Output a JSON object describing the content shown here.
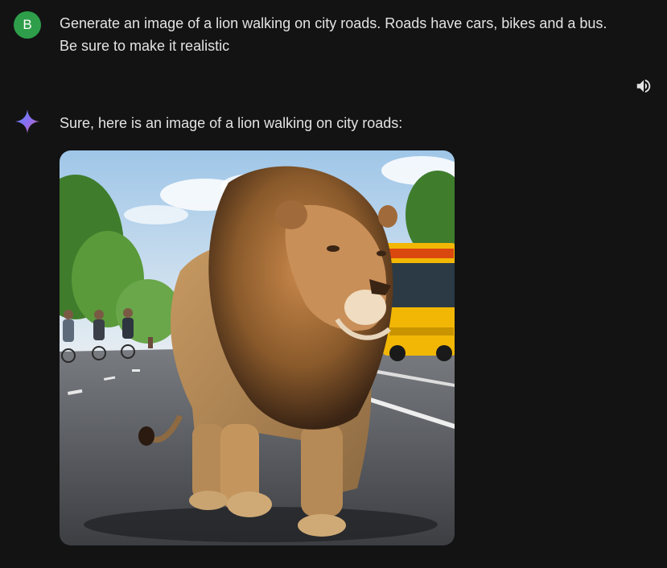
{
  "user": {
    "avatar_initial": "B",
    "avatar_color": "#2e9e4a",
    "prompt_line1": "Generate an image of a lion walking on city roads. Roads have cars, bikes and a bus.",
    "prompt_line2": "Be sure to make it realistic"
  },
  "response": {
    "speaker_icon": "speaker-volume-icon",
    "assistant_icon": "gemini-sparkle-icon",
    "text": "Sure, here is an image of a lion walking on city roads:",
    "image": {
      "subject": "lion walking on city road with cyclists and a yellow bus"
    }
  },
  "colors": {
    "background": "#131314",
    "text": "#e3e3e3",
    "bus": "#f2b705",
    "lion_mane": "#8a5a2b"
  }
}
